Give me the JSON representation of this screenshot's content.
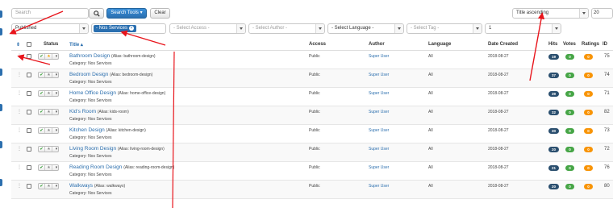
{
  "toolbar": {
    "search_placeholder": "Search",
    "search_tools_label": "Search Tools ▾",
    "clear_label": "Clear",
    "ordering_value": "Title ascending",
    "limit_value": "20"
  },
  "filters": {
    "published_value": "Published",
    "category_chip": "- Nos Services",
    "access_placeholder": "- Select Access -",
    "author_placeholder": "- Select Author -",
    "language_placeholder": "- Select Language -",
    "tag_placeholder": "- Select Tag -",
    "level_value": "1"
  },
  "table": {
    "columns": {
      "status": "Status",
      "title": "Title ▴",
      "access": "Access",
      "author": "Author",
      "language": "Language",
      "date_created": "Date Created",
      "hits": "Hits",
      "votes": "Votes",
      "ratings": "Ratings",
      "id": "ID"
    },
    "rows": [
      {
        "title": "Bathroom Design",
        "alias": "(Alias: bathroom-design)",
        "category": "Category: Nos Services",
        "access": "Public",
        "author": "Super User",
        "language": "All",
        "date": "2018-08-27",
        "hits": "19",
        "votes": "0",
        "ratings": "0",
        "id": "75",
        "featured": true
      },
      {
        "title": "Bedroom Design",
        "alias": "(Alias: bedroom-design)",
        "category": "Category: Nos Services",
        "access": "Public",
        "author": "Super User",
        "language": "All",
        "date": "2018-08-27",
        "hits": "37",
        "votes": "0",
        "ratings": "0",
        "id": "74",
        "featured": false
      },
      {
        "title": "Home Office Design",
        "alias": "(Alias: home-office-design)",
        "category": "Category: Nos Services",
        "access": "Public",
        "author": "Super User",
        "language": "All",
        "date": "2018-08-27",
        "hits": "39",
        "votes": "0",
        "ratings": "0",
        "id": "71",
        "featured": false
      },
      {
        "title": "Kid's Room",
        "alias": "(Alias: kids-room)",
        "category": "Category: Nos Services",
        "access": "Public",
        "author": "Super User",
        "language": "All",
        "date": "2018-08-27",
        "hits": "32",
        "votes": "0",
        "ratings": "0",
        "id": "82",
        "featured": false
      },
      {
        "title": "Kitchen Design",
        "alias": "(Alias: kitchen-design)",
        "category": "Category: Nos Services",
        "access": "Public",
        "author": "Super User",
        "language": "All",
        "date": "2018-08-27",
        "hits": "30",
        "votes": "0",
        "ratings": "0",
        "id": "73",
        "featured": false
      },
      {
        "title": "Living Room Design",
        "alias": "(Alias: living-room-design)",
        "category": "Category: Nos Services",
        "access": "Public",
        "author": "Super User",
        "language": "All",
        "date": "2018-08-27",
        "hits": "20",
        "votes": "0",
        "ratings": "0",
        "id": "72",
        "featured": false
      },
      {
        "title": "Reading Room Design",
        "alias": "(Alias: reading-room-design)",
        "category": "Category: Nos Services",
        "access": "Public",
        "author": "Super User",
        "language": "All",
        "date": "2018-08-27",
        "hits": "21",
        "votes": "0",
        "ratings": "0",
        "id": "76",
        "featured": false
      },
      {
        "title": "Walkways",
        "alias": "(Alias: walkways)",
        "category": "Category: Nos Services",
        "access": "Public",
        "author": "Super User",
        "language": "All",
        "date": "2018-08-27",
        "hits": "20",
        "votes": "0",
        "ratings": "0",
        "id": "80",
        "featured": false
      }
    ]
  }
}
